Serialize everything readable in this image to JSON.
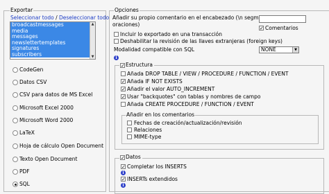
{
  "exportar": {
    "legend": "Exportar",
    "select_all": "Seleccionar todo",
    "separator": " / ",
    "deselect_all": "Deseleccionar todo",
    "tables": [
      "broadcastmessages",
      "media",
      "messages",
      "newslettertemplates",
      "signatures",
      "subscribers"
    ],
    "formats": [
      {
        "label": "CodeGen",
        "selected": false
      },
      {
        "label": "Datos CSV",
        "selected": false
      },
      {
        "label": "CSV para datos de MS Excel",
        "selected": false
      },
      {
        "label": "Microsoft Excel 2000",
        "selected": false
      },
      {
        "label": "Microsoft Word 2000",
        "selected": false
      },
      {
        "label": "LaTeX",
        "selected": false
      },
      {
        "label": "Hoja de cálculo Open Document",
        "selected": false
      },
      {
        "label": "Texto Open Document",
        "selected": false
      },
      {
        "label": "PDF",
        "selected": false
      },
      {
        "label": "SQL",
        "selected": true
      }
    ]
  },
  "opciones": {
    "legend": "Opciones",
    "comment_label_line1": "Añadir su propio comentario en el encabezado (\\n segmenta las",
    "comment_label_line2": "oraciones)",
    "comment_value": "",
    "comentarios_label": "Comentarios",
    "comentarios_checked": true,
    "include_transaction": "Incluir lo exportado en una transacción",
    "disable_fk": "Deshabilitar la revisión de las llaves extranjeras (foreign keys)",
    "sql_mode_label": "Modalidad compatible con SQL",
    "sql_mode_value": "NONE",
    "estructura": {
      "legend": "Estructura",
      "checked": true,
      "items": [
        {
          "label": "Añada DROP TABLE / VIEW / PROCEDURE / FUNCTION / EVENT",
          "checked": false
        },
        {
          "label": "Añada IF NOT EXISTS",
          "checked": true
        },
        {
          "label": "Añadir el valor AUTO_INCREMENT",
          "checked": true
        },
        {
          "label": "Usar \"backquotes\" con tablas y nombres de campo",
          "checked": true
        },
        {
          "label": "Añada CREATE PROCEDURE / FUNCTION / EVENT",
          "checked": false
        }
      ],
      "comentarios_sub": {
        "legend": "Añadir en los comentarios",
        "items": [
          {
            "label": "Fechas de creación/actualización/revisión",
            "checked": false
          },
          {
            "label": "Relaciones",
            "checked": false
          },
          {
            "label": "MIME-type",
            "checked": false
          }
        ]
      }
    },
    "datos": {
      "legend": "Datos",
      "checked": true,
      "items": [
        {
          "label": "Completar los INSERTS",
          "checked": true
        },
        {
          "label": "INSERTs extendidos",
          "checked": true
        }
      ]
    }
  }
}
